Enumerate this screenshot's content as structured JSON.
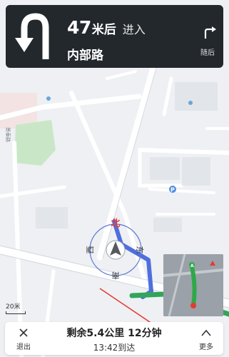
{
  "guidance": {
    "distance": "47",
    "distance_unit": "米后",
    "action": "进入",
    "road_name": "内部路",
    "turn_icon": "u-turn-icon",
    "then_icon": "turn-right-icon",
    "then_label": "随后"
  },
  "compass": {
    "north": "北",
    "east": "东",
    "south": "南",
    "west": "西"
  },
  "map": {
    "road_label": "景泰路",
    "route_color": "#4f6ee0",
    "overview_route_color": "#2fa84a"
  },
  "scale": {
    "label": "20米"
  },
  "bottom": {
    "exit_label": "退出",
    "remaining": "剩余5.4公里 12分钟",
    "eta": "13:42到达",
    "more_label": "更多"
  }
}
